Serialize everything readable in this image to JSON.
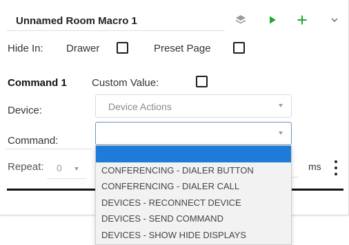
{
  "macro": {
    "title": "Unnamed Room Macro 1",
    "colors": {
      "play": "#1faa2e",
      "plus": "#1faa2e",
      "selected": "#1e7bd8"
    }
  },
  "hide_in": {
    "label": "Hide In:",
    "drawer_label": "Drawer",
    "drawer_checked": false,
    "preset_label": "Preset Page",
    "preset_checked": false
  },
  "command": {
    "title": "Command 1",
    "custom_value_label": "Custom Value:",
    "custom_value_checked": false,
    "device_label": "Device:",
    "device_value": "Device Actions",
    "command_label": "Command:",
    "command_value": "",
    "repeat_label": "Repeat:",
    "repeat_value": "0",
    "ms_label": "ms"
  },
  "dropdown": {
    "options": [
      "",
      "CONFERENCING - DIALER BUTTON",
      "CONFERENCING - DIALER CALL",
      "DEVICES - RECONNECT DEVICE",
      "DEVICES - SEND COMMAND",
      "DEVICES - SHOW HIDE DISPLAYS"
    ],
    "selected_index": 0
  },
  "icons": {
    "layers": "layers-icon",
    "play": "play-icon",
    "plus": "plus-icon",
    "chevron": "chevron-down-icon",
    "more": "more-vertical-icon"
  }
}
